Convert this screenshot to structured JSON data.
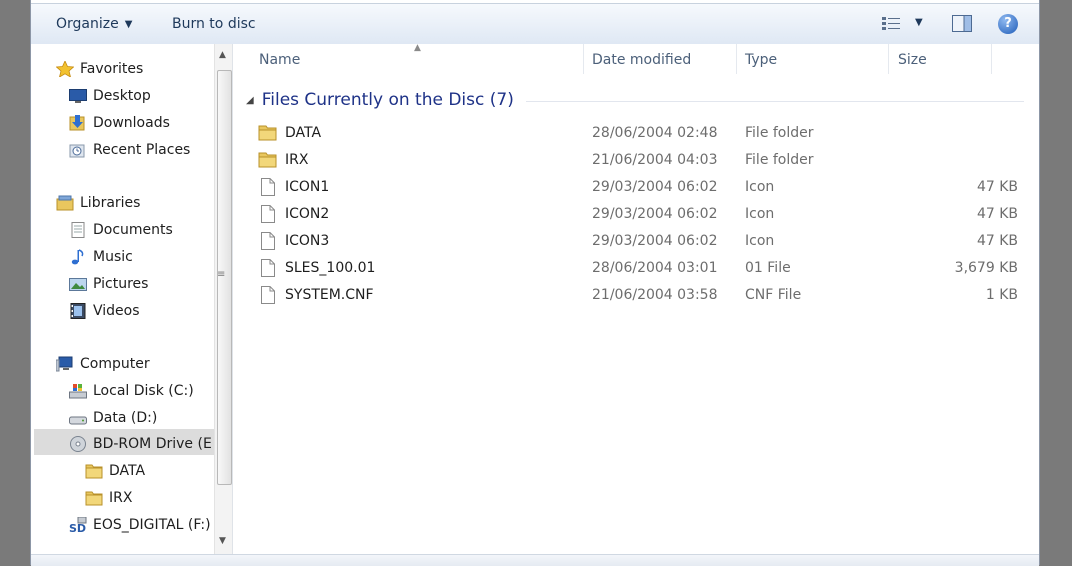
{
  "toolbar": {
    "organize_label": "Organize",
    "burn_label": "Burn to disc",
    "help_glyph": "?"
  },
  "nav": {
    "favorites": [
      {
        "label": "Favorites",
        "icon": "star-icon"
      },
      {
        "label": "Desktop",
        "icon": "desktop-icon"
      },
      {
        "label": "Downloads",
        "icon": "downloads-icon"
      },
      {
        "label": "Recent Places",
        "icon": "recent-places-icon"
      }
    ],
    "libraries": [
      {
        "label": "Libraries",
        "icon": "libraries-icon"
      },
      {
        "label": "Documents",
        "icon": "documents-icon"
      },
      {
        "label": "Music",
        "icon": "music-icon"
      },
      {
        "label": "Pictures",
        "icon": "pictures-icon"
      },
      {
        "label": "Videos",
        "icon": "videos-icon"
      }
    ],
    "computer": [
      {
        "label": "Computer",
        "icon": "computer-icon"
      },
      {
        "label": "Local Disk (C:)",
        "icon": "local-disk-icon"
      },
      {
        "label": "Data (D:)",
        "icon": "drive-icon"
      },
      {
        "label": "BD-ROM Drive (E",
        "icon": "disc-icon",
        "selected": true
      },
      {
        "label": "DATA",
        "icon": "folder-icon"
      },
      {
        "label": "IRX",
        "icon": "folder-icon"
      },
      {
        "label": "EOS_DIGITAL (F:)",
        "icon": "sd-card-icon"
      }
    ]
  },
  "columns": {
    "name": "Name",
    "date": "Date modified",
    "type": "Type",
    "size": "Size"
  },
  "group": {
    "title": "Files Currently on the Disc (7)"
  },
  "files": [
    {
      "name": "DATA",
      "date": "28/06/2004 02:48",
      "type": "File folder",
      "size": "",
      "icon": "folder-icon"
    },
    {
      "name": "IRX",
      "date": "21/06/2004 04:03",
      "type": "File folder",
      "size": "",
      "icon": "folder-icon"
    },
    {
      "name": "ICON1",
      "date": "29/03/2004 06:02",
      "type": "Icon",
      "size": "47 KB",
      "icon": "file-icon"
    },
    {
      "name": "ICON2",
      "date": "29/03/2004 06:02",
      "type": "Icon",
      "size": "47 KB",
      "icon": "file-icon"
    },
    {
      "name": "ICON3",
      "date": "29/03/2004 06:02",
      "type": "Icon",
      "size": "47 KB",
      "icon": "file-icon"
    },
    {
      "name": "SLES_100.01",
      "date": "28/06/2004 03:01",
      "type": "01 File",
      "size": "3,679 KB",
      "icon": "file-icon"
    },
    {
      "name": "SYSTEM.CNF",
      "date": "21/06/2004 03:58",
      "type": "CNF File",
      "size": "1 KB",
      "icon": "file-icon"
    }
  ],
  "colors": {
    "toolbar_text": "#1e395b",
    "group_header": "#1e3287",
    "column_header": "#4c607a",
    "selected_nav": "#dcdcdc"
  }
}
